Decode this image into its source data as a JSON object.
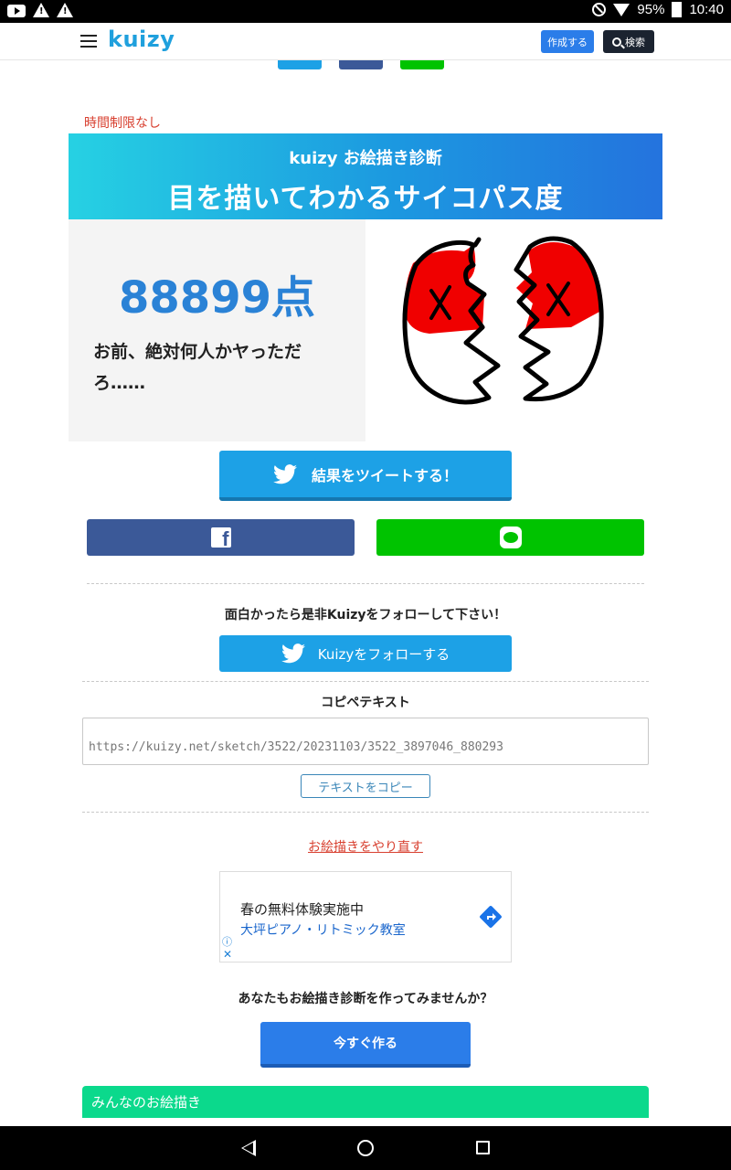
{
  "status_bar": {
    "battery": "95%",
    "time": "10:40",
    "icons": [
      "youtube-icon",
      "warning-icon",
      "warning-icon",
      "do-not-disturb-icon",
      "wifi-icon",
      "battery-icon"
    ]
  },
  "header": {
    "logo": "kuizy",
    "create_label": "作成する",
    "search_label": "検索"
  },
  "quiz": {
    "time_limit": "時間制限なし",
    "banner_sub": "kuizy お絵描き診断",
    "banner_title": "目を描いてわかるサイコパス度",
    "score": "88899点",
    "comment": "お前、絶対何人かヤっただろ……"
  },
  "share": {
    "tweet_label": "結果をツイートする！",
    "colors": {
      "twitter": "#1da1e6",
      "facebook": "#3b5998",
      "line": "#00c300"
    }
  },
  "follow": {
    "prompt": "面白かったら是非Kuizyをフォローして下さい！",
    "button_label": "Kuizyをフォローする"
  },
  "copy": {
    "title": "コピペテキスト",
    "url": "https://kuizy.net/sketch/3522/20231103/3522_3897046_880293",
    "button_label": "テキストをコピー"
  },
  "redo_label": "お絵描きをやり直す",
  "ad": {
    "line1": "春の無料体験実施中",
    "line2": "大坪ピアノ・リトミック教室"
  },
  "cta": {
    "prompt": "あなたもお絵描き診断を作ってみませんか？",
    "button_label": "今すぐ作る"
  },
  "section_title": "みんなのお絵描き"
}
